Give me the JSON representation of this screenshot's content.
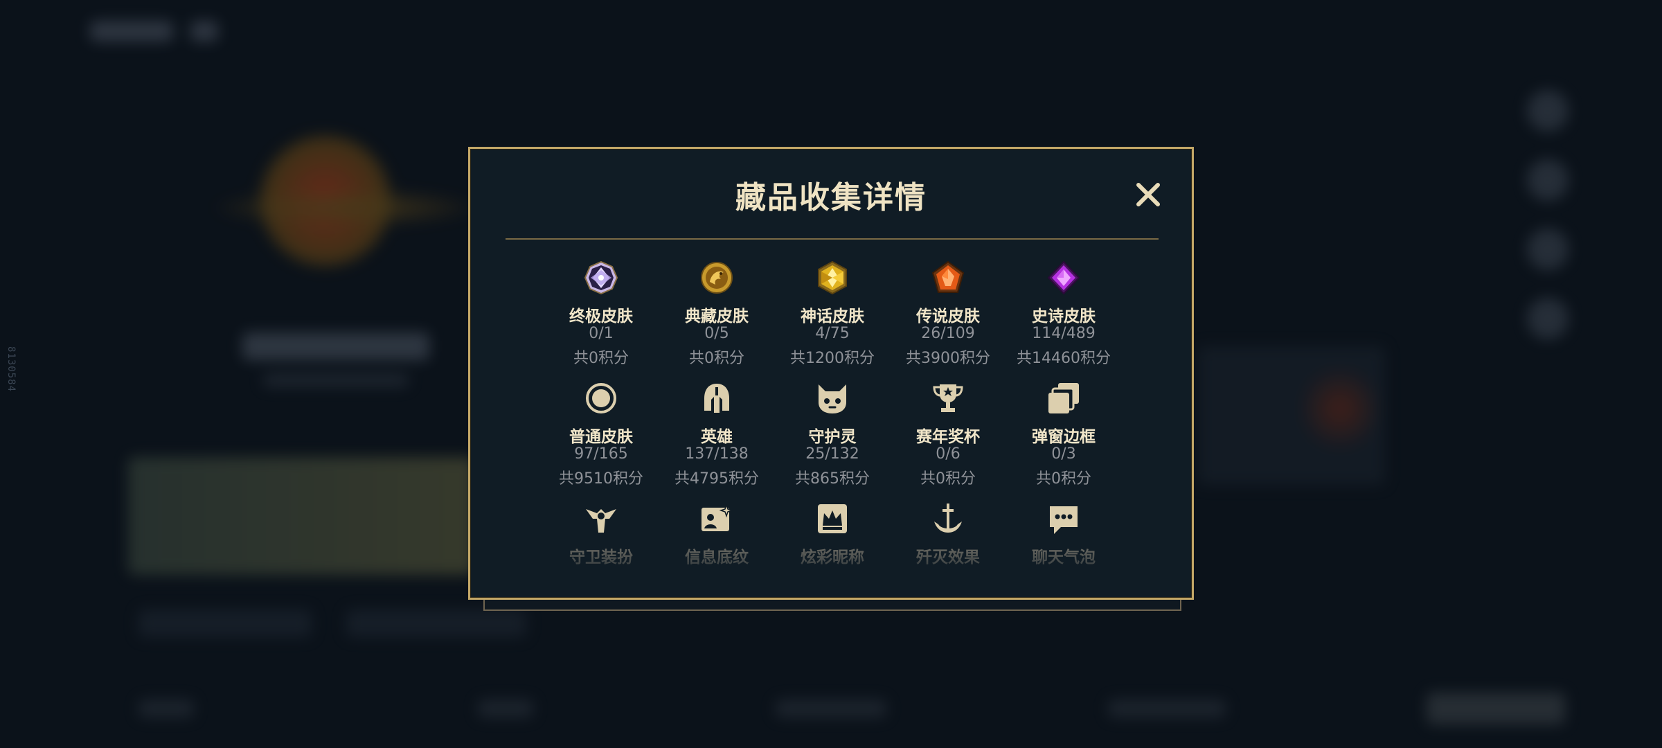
{
  "background": {
    "side_id": "8130584"
  },
  "modal": {
    "title": "藏品收集详情",
    "close_label": "✕",
    "rows": [
      [
        {
          "name": "终极皮肤",
          "count": "0/1",
          "points": "共0积分",
          "icon": "ultimate-gem-icon"
        },
        {
          "name": "典藏皮肤",
          "count": "0/5",
          "points": "共0积分",
          "icon": "dragon-medallion-icon"
        },
        {
          "name": "神话皮肤",
          "count": "4/75",
          "points": "共1200积分",
          "icon": "gold-hexagon-gem-icon"
        },
        {
          "name": "传说皮肤",
          "count": "26/109",
          "points": "共3900积分",
          "icon": "orange-pentagon-gem-icon"
        },
        {
          "name": "史诗皮肤",
          "count": "114/489",
          "points": "共14460积分",
          "icon": "purple-diamond-gem-icon"
        }
      ],
      [
        {
          "name": "普通皮肤",
          "count": "97/165",
          "points": "共9510积分",
          "icon": "ring-circle-icon"
        },
        {
          "name": "英雄",
          "count": "137/138",
          "points": "共4795积分",
          "icon": "helmet-icon"
        },
        {
          "name": "守护灵",
          "count": "25/132",
          "points": "共865积分",
          "icon": "guardian-face-icon"
        },
        {
          "name": "赛年奖杯",
          "count": "0/6",
          "points": "共0积分",
          "icon": "trophy-icon"
        },
        {
          "name": "弹窗边框",
          "count": "0/3",
          "points": "共0积分",
          "icon": "stacked-frames-icon"
        }
      ],
      [
        {
          "name": "守卫装扮",
          "icon": "ward-statue-icon"
        },
        {
          "name": "信息底纹",
          "icon": "card-sparkle-icon"
        },
        {
          "name": "炫彩昵称",
          "icon": "crown-badge-icon"
        },
        {
          "name": "歼灭效果",
          "icon": "anchor-sword-icon"
        },
        {
          "name": "聊天气泡",
          "icon": "chat-bubble-icon"
        }
      ]
    ]
  },
  "colors": {
    "frame_gold": "#c3a767",
    "title_text": "#efe3c3",
    "muted_text": "#8f9298"
  }
}
